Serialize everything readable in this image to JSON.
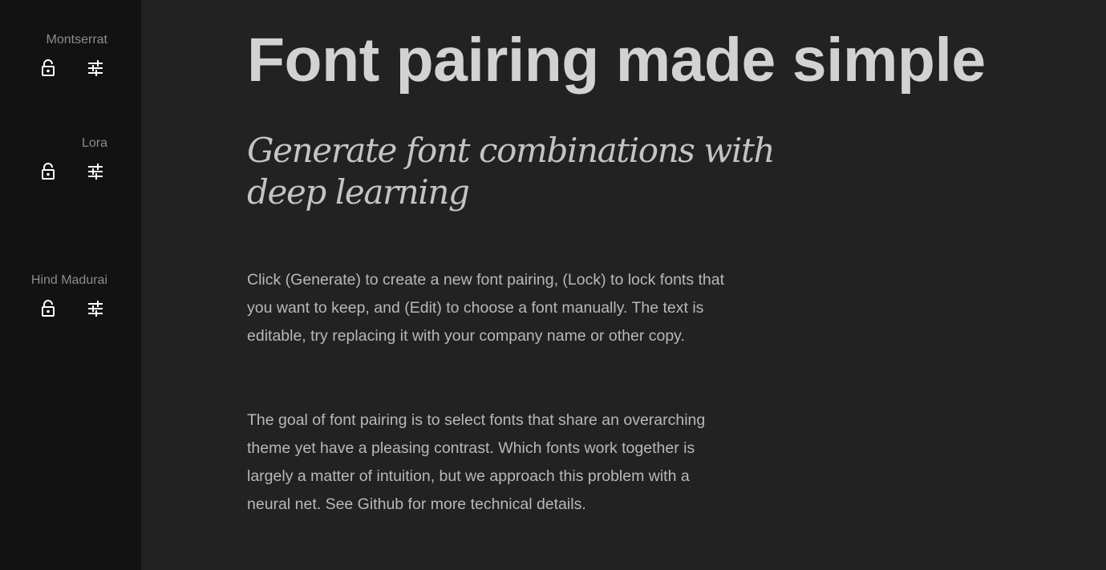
{
  "sidebar": {
    "fonts": [
      {
        "name": "Montserrat"
      },
      {
        "name": "Lora"
      },
      {
        "name": "Hind Madurai"
      }
    ]
  },
  "main": {
    "headline": "Font pairing made simple",
    "subheadline": "Generate font combinations with deep learning",
    "paragraphs": [
      "Click (Generate) to create a new font pairing, (Lock) to lock fonts that you want to keep, and (Edit) to choose a font manually. The text is editable, try replacing it with your company name or other copy.",
      "The goal of font pairing is to select fonts that share an overarching theme yet have a pleasing contrast. Which fonts work together is largely a matter of intuition, but we approach this problem with a neural net. See Github for more technical details."
    ]
  },
  "icons": {
    "lock": "lock-open-icon",
    "edit": "tune-sliders-icon"
  },
  "colors": {
    "sidebar_bg": "#121212",
    "main_bg": "#222222",
    "headline": "#d2d2d2",
    "body": "#b8b8b8",
    "sidebar_label": "#8c8c8c",
    "icon": "#ffffff"
  }
}
